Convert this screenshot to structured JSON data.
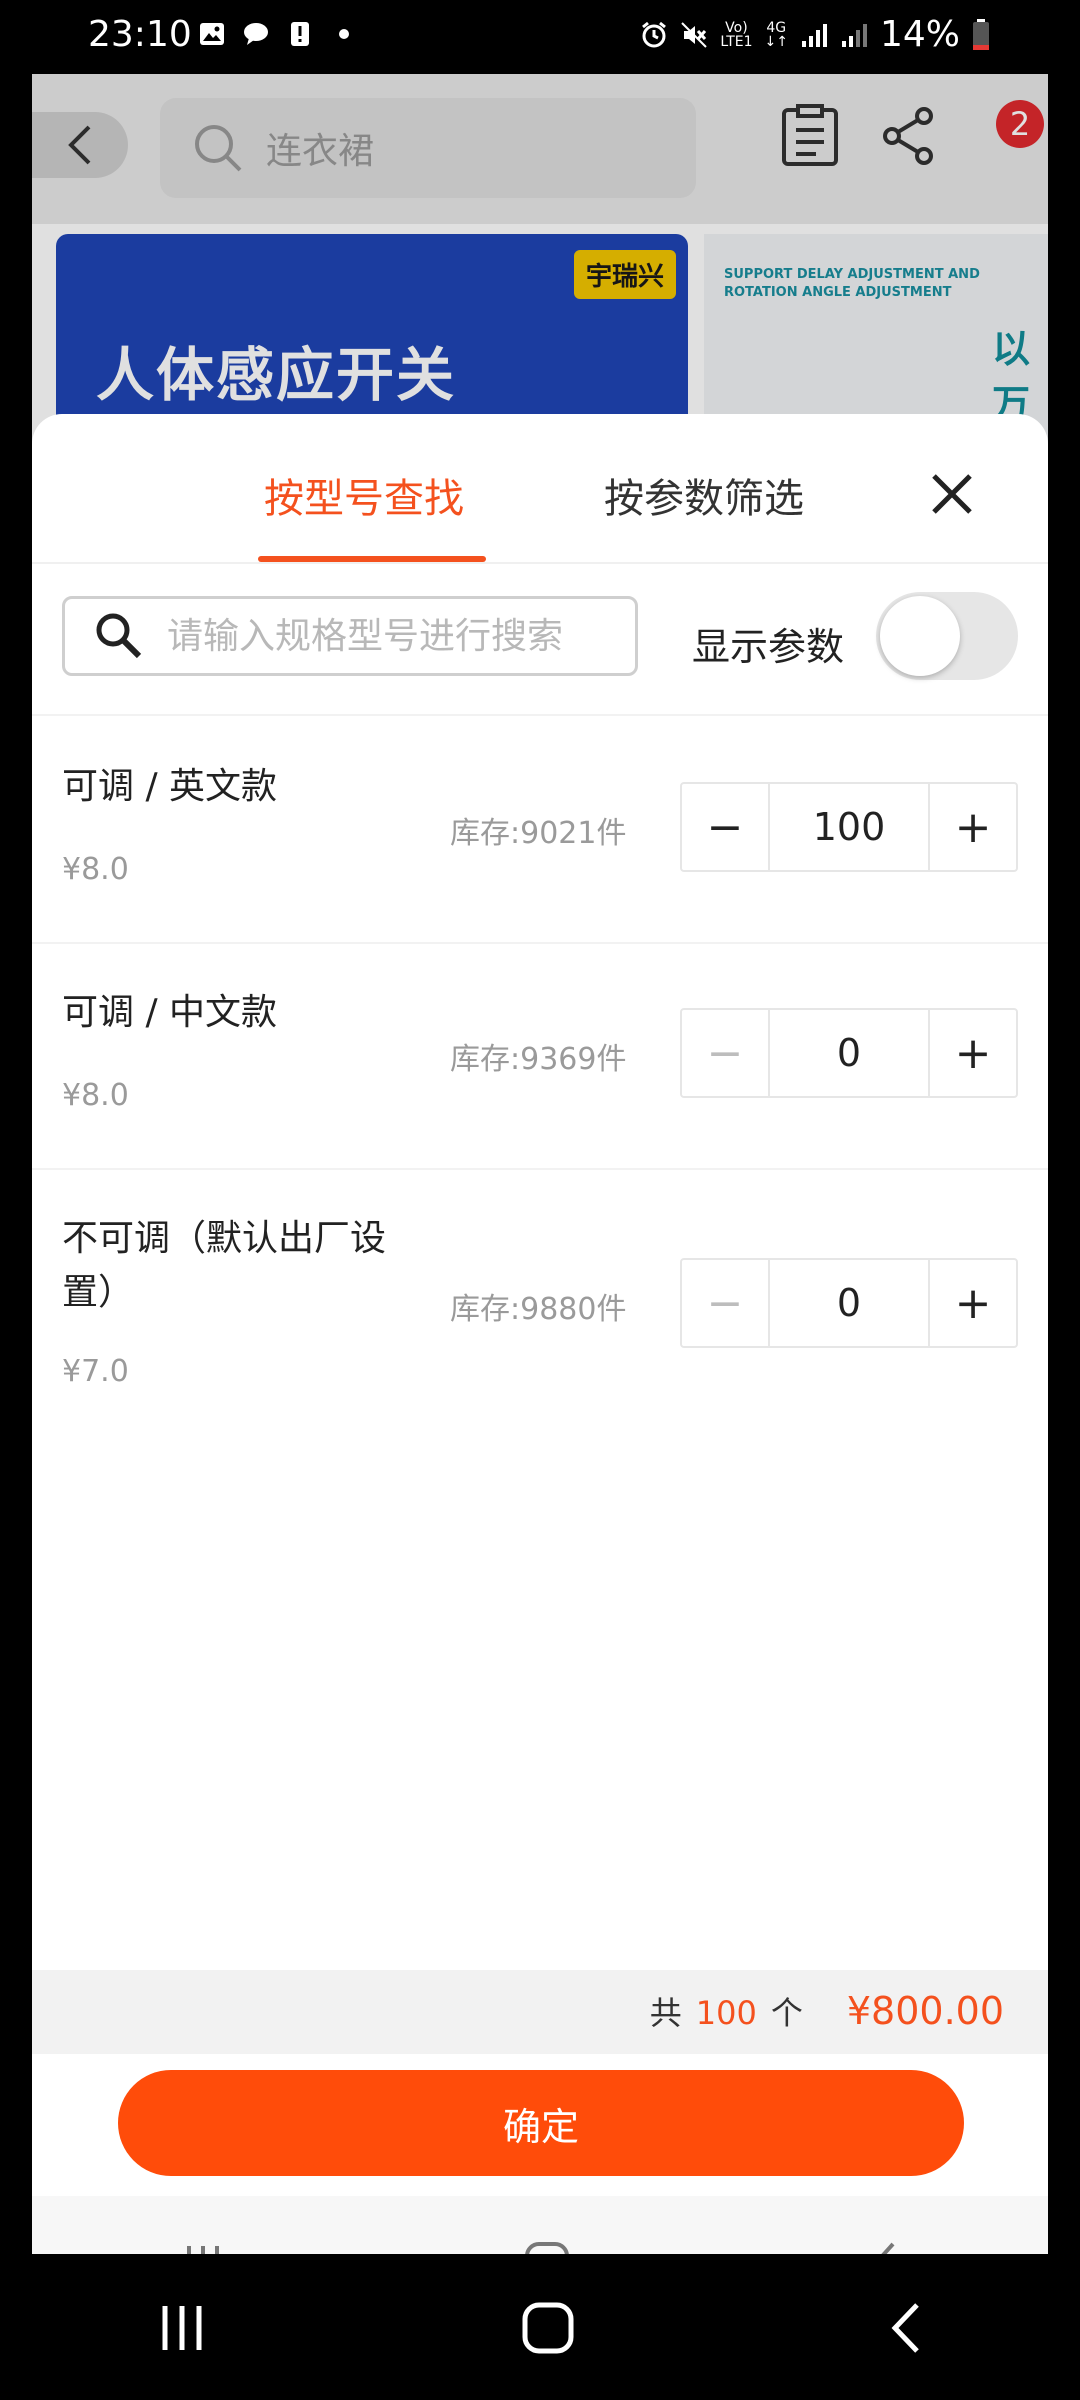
{
  "status_bar": {
    "time": "23:10",
    "network_top": "Vo)",
    "network_bottom": "LTE1",
    "gen": "4G",
    "battery": "14%"
  },
  "background": {
    "search_placeholder": "连衣裙",
    "cart_badge": "2",
    "banner_title": "人体感应开关",
    "banner_brand": "宇瑞兴",
    "banner_right_en_line1": "SUPPORT DELAY ADJUSTMENT AND",
    "banner_right_en_line2": "ROTATION ANGLE ADJUSTMENT",
    "banner_right_cn": "以万"
  },
  "sheet": {
    "tabs": [
      {
        "label": "按型号查找",
        "active": true
      },
      {
        "label": "按参数筛选",
        "active": false
      }
    ],
    "search_placeholder": "请输入规格型号进行搜索",
    "show_params_label": "显示参数",
    "show_params_on": false,
    "variants": [
      {
        "name": "可调 / 英文款",
        "price": "¥8.0",
        "stock": "库存:9021件",
        "qty": "100"
      },
      {
        "name": "可调 / 中文款",
        "price": "¥8.0",
        "stock": "库存:9369件",
        "qty": "0"
      },
      {
        "name": "不可调（默认出厂设置）",
        "price": "¥7.0",
        "stock": "库存:9880件",
        "qty": "0"
      }
    ],
    "summary": {
      "prefix": "共",
      "count": "100",
      "unit": "个",
      "total": "¥800.00"
    },
    "confirm_label": "确定"
  },
  "colors": {
    "accent": "#f4511e",
    "button": "#ff4c0a"
  }
}
